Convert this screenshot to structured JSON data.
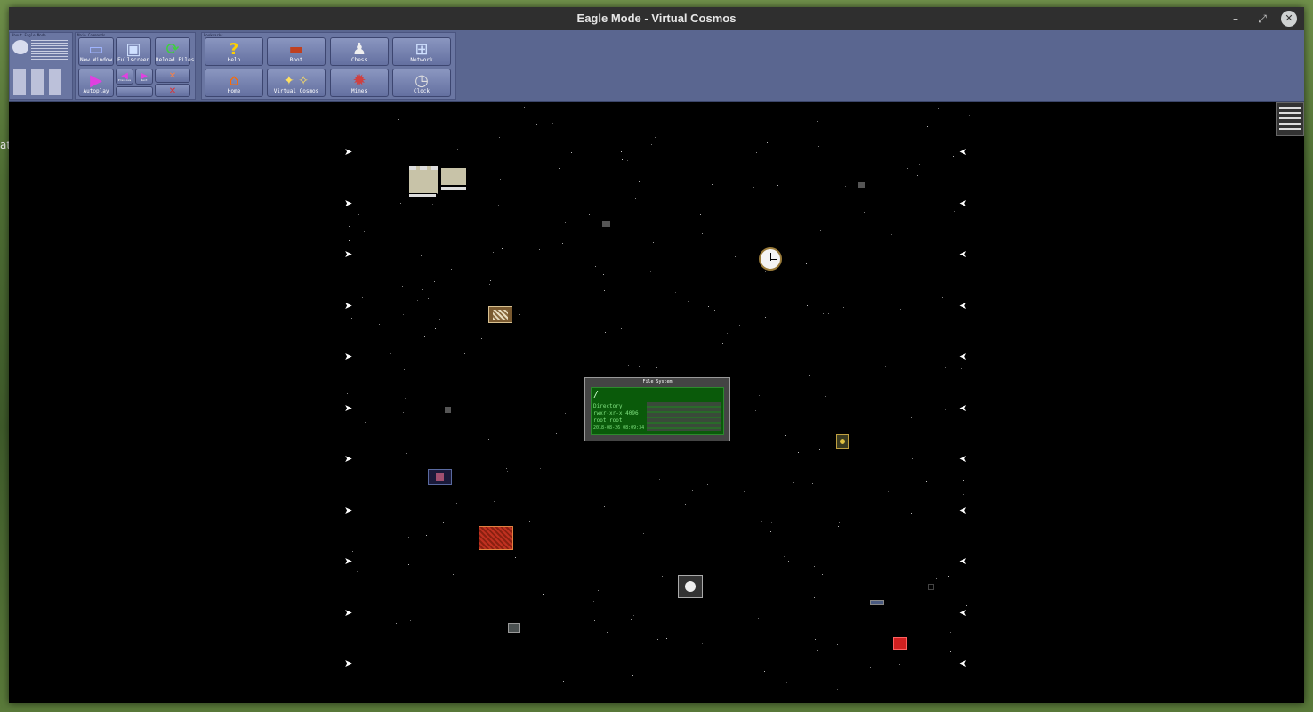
{
  "desktop": {
    "edge_text": "at"
  },
  "window": {
    "title": "Eagle Mode - Virtual Cosmos",
    "minimize_glyph": "–",
    "maximize_glyph": "⤢",
    "close_glyph": "✕"
  },
  "toolbar": {
    "about_label": "About Eagle Mode",
    "main_commands_label": "Main Commands",
    "bookmarks_label": "Bookmarks",
    "buttons": {
      "new_window": "New Window",
      "fullscreen": "Fullscreen",
      "reload_files": "Reload Files",
      "autoplay": "Autoplay",
      "previous": "Previous",
      "next": "Next",
      "help": "Help",
      "root": "Root",
      "chess": "Chess",
      "network": "Network",
      "home": "Home",
      "virtual_cosmos": "Virtual Cosmos",
      "mines": "Mines",
      "clock": "Clock"
    }
  },
  "file_system": {
    "header": "File System",
    "path": "/",
    "type": "Directory",
    "perms_line": "rwxr-xr-x 4096",
    "owner_line": "root   root",
    "date_line": "2018-08-26 08:09:34"
  },
  "colors": {
    "toolbar": "#5a6690",
    "fs_green": "#0a5a0a",
    "space": "#000000"
  }
}
